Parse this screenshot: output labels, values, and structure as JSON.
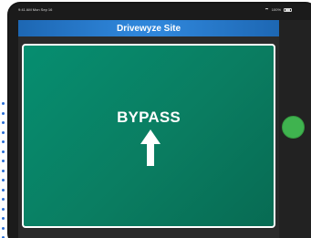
{
  "status_bar": {
    "time_date": "9:41 AM  Mon Sep 16",
    "battery": "100%"
  },
  "header": {
    "title": "Drivewyze Site"
  },
  "sign": {
    "text": "BYPASS",
    "arrow_icon": "arrow-up-icon"
  },
  "colors": {
    "header_blue": "#2f86da",
    "sign_green": "#0a7d61",
    "button_green": "#3fb34f"
  },
  "icons": {
    "wifi": "wifi-icon",
    "battery": "battery-icon"
  }
}
